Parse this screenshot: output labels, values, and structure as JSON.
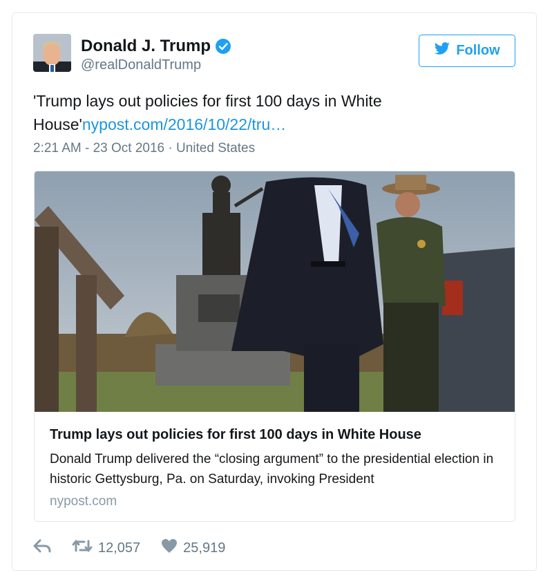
{
  "author": {
    "name": "Donald J. Trump",
    "handle": "@realDonaldTrump",
    "verified": true
  },
  "follow_button": {
    "label": "Follow",
    "icon": "twitter-bird-icon"
  },
  "tweet": {
    "text": "'Trump lays out policies for first 100 days in White House'",
    "link": "nypost.com/2016/10/22/tru…",
    "timestamp": "2:21 AM - 23 Oct 2016",
    "separator": "·",
    "location": "United States"
  },
  "card": {
    "title": "Trump lays out policies for first 100 days in White House",
    "description": "Donald Trump delivered the “closing argument” to the presidential election in historic Gettysburg, Pa. on Saturday, invoking President",
    "domain": "nypost.com"
  },
  "actions": {
    "reply_icon": "reply-icon",
    "retweet_icon": "retweet-icon",
    "retweet_count": "12,057",
    "like_icon": "heart-icon",
    "like_count": "25,919"
  },
  "colors": {
    "accent": "#1da1f2",
    "link": "#1b95e0",
    "secondary_text": "#657786",
    "border": "#e1e8ed"
  }
}
